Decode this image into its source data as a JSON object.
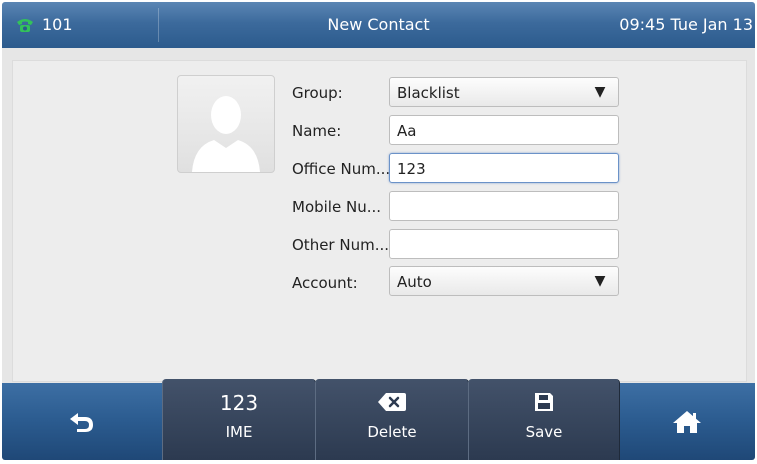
{
  "status_bar": {
    "line_label": "101",
    "title": "New Contact",
    "clock": "09:45 Tue Jan 13",
    "phone_icon": "phone-icon"
  },
  "form": {
    "avatar_icon": "contact-placeholder-icon",
    "rows": [
      {
        "label": "Group:",
        "value": "Blacklist",
        "type": "select"
      },
      {
        "label": "Name:",
        "value": "Aa",
        "type": "text"
      },
      {
        "label": "Office Num...",
        "value": "123",
        "type": "text",
        "focused": true
      },
      {
        "label": "Mobile Nu...",
        "value": "",
        "type": "text"
      },
      {
        "label": "Other Num...",
        "value": "",
        "type": "text"
      },
      {
        "label": "Account:",
        "value": "Auto",
        "type": "select"
      }
    ],
    "dropdown_arrow": "▼"
  },
  "softkeys": {
    "back_icon": "back-arrow-icon",
    "ime": {
      "top": "123",
      "label": "IME"
    },
    "delete": {
      "label": "Delete",
      "icon": "backspace-icon"
    },
    "save": {
      "label": "Save",
      "icon": "floppy-disk-icon"
    },
    "home_icon": "home-icon"
  },
  "colors": {
    "accent_blue": "#3c6a9c",
    "accent_green": "#2fbf58",
    "background": "#e6e6e6"
  }
}
